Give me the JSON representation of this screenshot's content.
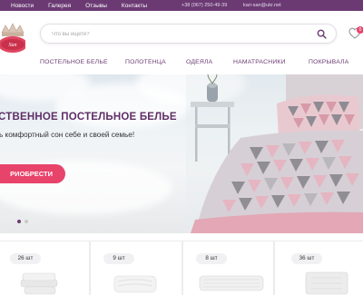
{
  "topbar": {
    "nav": [
      "Новости",
      "Галерея",
      "Отзывы",
      "Контакты"
    ],
    "phone": "+38 (067) 250-49-39",
    "email": "kari-san@ukr.net"
  },
  "search": {
    "placeholder": "Что вы ищете?"
  },
  "favorites": {
    "count": "0"
  },
  "categories": [
    "ПОСТЕЛЬНОЕ БЕЛЬЕ",
    "ПОЛОТЕНЦА",
    "ОДЕЯЛА",
    "НАМАТРАСНИКИ",
    "ПОКРЫВАЛА"
  ],
  "hero": {
    "title": "СТВЕННОЕ ПОСТЕЛЬНОЕ БЕЛЬЕ",
    "subtitle": "ь комфортный сон себе и своей семье!",
    "button": "РИОБРЕСТИ",
    "slides": 2,
    "active_slide": 1
  },
  "products": [
    {
      "count": "26 шт"
    },
    {
      "count": "9 шт"
    },
    {
      "count": "8 шт"
    },
    {
      "count": "36 шт"
    }
  ],
  "colors": {
    "brand": "#6b3a73",
    "accent": "#e8436b"
  }
}
